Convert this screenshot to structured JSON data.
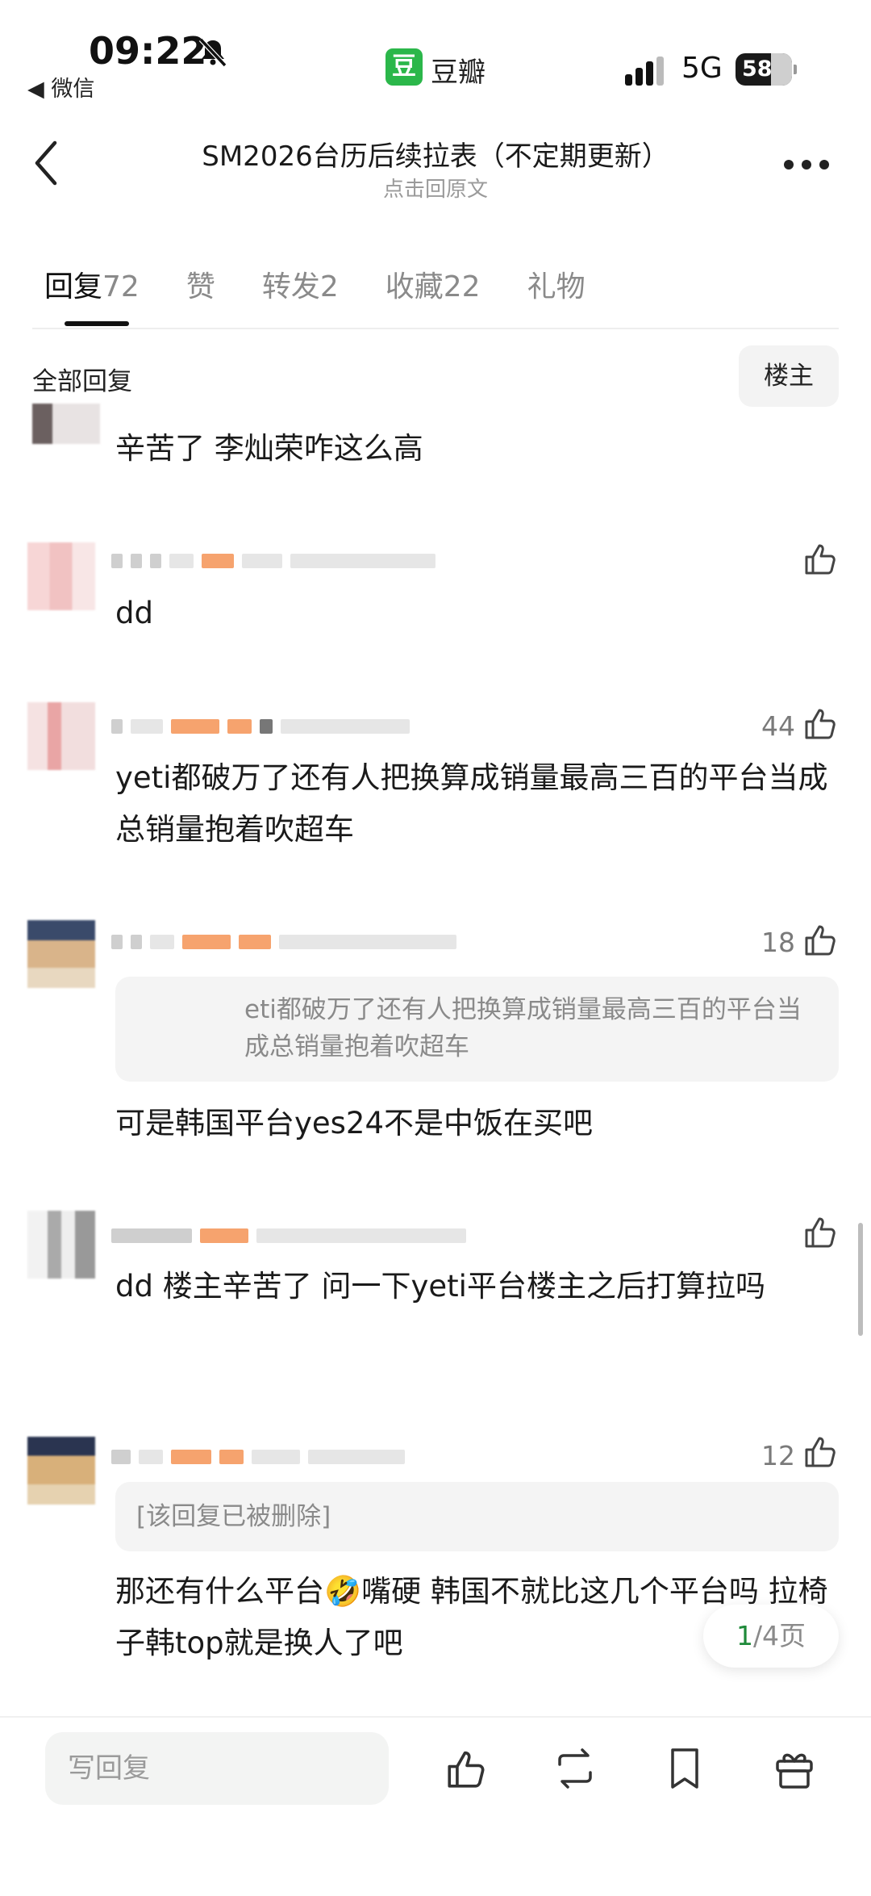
{
  "status": {
    "time": "09:22",
    "back_app": "◀ 微信",
    "app_badge": "豆",
    "app_name": "豆瓣",
    "network": "5G",
    "battery": "58"
  },
  "header": {
    "title": "SM2026台历后续拉表（不定期更新）",
    "subtitle": "点击回原文",
    "back_icon": "chevron-left-icon",
    "more_icon": "more-icon"
  },
  "tabs": [
    {
      "label": "回复",
      "count": "72",
      "active": true
    },
    {
      "label": "赞",
      "count": ""
    },
    {
      "label": "转发",
      "count": "2"
    },
    {
      "label": "收藏",
      "count": "22"
    },
    {
      "label": "礼物",
      "count": ""
    }
  ],
  "filter": {
    "all_label": "全部回复",
    "op_label": "楼主"
  },
  "comments": [
    {
      "text": "辛苦了 李灿荣咋这么高"
    },
    {
      "text": "dd",
      "likes": ""
    },
    {
      "text": "yeti都破万了还有人把换算成销量最高三百的平台当成总销量抱着吹超车",
      "likes": "44"
    },
    {
      "quote": "eti都破万了还有人把换算成销量最高三百的平台当成总销量抱着吹超车",
      "text": "可是韩国平台yes24不是中饭在买吧",
      "likes": "18"
    },
    {
      "text": "dd 楼主辛苦了 问一下yeti平台楼主之后打算拉吗",
      "likes": ""
    },
    {
      "quote": "[该回复已被删除]",
      "text": "那还有什么平台🤣嘴硬 韩国不就比这几个平台吗  拉椅子韩top就是换人了吧",
      "likes": "12"
    }
  ],
  "pager": {
    "current": "1",
    "total": "/4页"
  },
  "bottom": {
    "reply_placeholder": "写回复"
  }
}
